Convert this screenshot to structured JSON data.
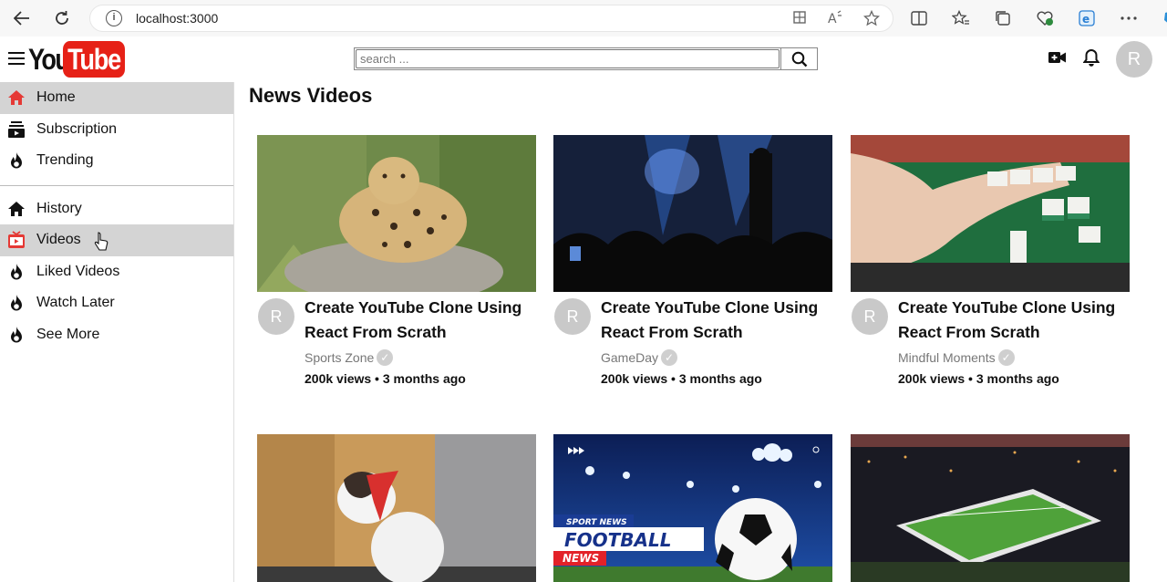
{
  "browser": {
    "url": "localhost:3000"
  },
  "header": {
    "logo_you": "You",
    "logo_tube": "Tube",
    "search_placeholder": "search ...",
    "avatar_letter": "R"
  },
  "sidebar": {
    "items_top": [
      {
        "label": "Home",
        "icon": "home-icon",
        "active": true
      },
      {
        "label": "Subscription",
        "icon": "subscription-icon",
        "active": false
      },
      {
        "label": "Trending",
        "icon": "fire-icon",
        "active": false
      }
    ],
    "items_bottom": [
      {
        "label": "History",
        "icon": "home-icon",
        "active": false
      },
      {
        "label": "Videos",
        "icon": "video-icon",
        "active": true
      },
      {
        "label": "Liked Videos",
        "icon": "fire-icon",
        "active": false
      },
      {
        "label": "Watch Later",
        "icon": "fire-icon",
        "active": false
      },
      {
        "label": "See More",
        "icon": "fire-icon",
        "active": false
      }
    ]
  },
  "main": {
    "title": "News Videos",
    "videos": [
      {
        "title": "Create YouTube Clone Using React From Scrath",
        "channel": "Sports Zone",
        "stats": "200k views • 3 months ago",
        "avatar": "R",
        "thumb": "leopard"
      },
      {
        "title": "Create YouTube Clone Using React From Scrath",
        "channel": "GameDay",
        "stats": "200k views • 3 months ago",
        "avatar": "R",
        "thumb": "concert"
      },
      {
        "title": "Create YouTube Clone Using React From Scrath",
        "channel": "Mindful Moments",
        "stats": "200k views • 3 months ago",
        "avatar": "R",
        "thumb": "mahjong"
      },
      {
        "title": "",
        "channel": "",
        "stats": "",
        "avatar": "",
        "thumb": "cat"
      },
      {
        "title": "",
        "channel": "",
        "stats": "",
        "avatar": "",
        "thumb": "football",
        "thumb_text": {
          "top": "SPORT NEWS",
          "main": "FOOTBALL",
          "bottom": "NEWS"
        }
      },
      {
        "title": "",
        "channel": "",
        "stats": "",
        "avatar": "",
        "thumb": "stadium"
      }
    ]
  }
}
